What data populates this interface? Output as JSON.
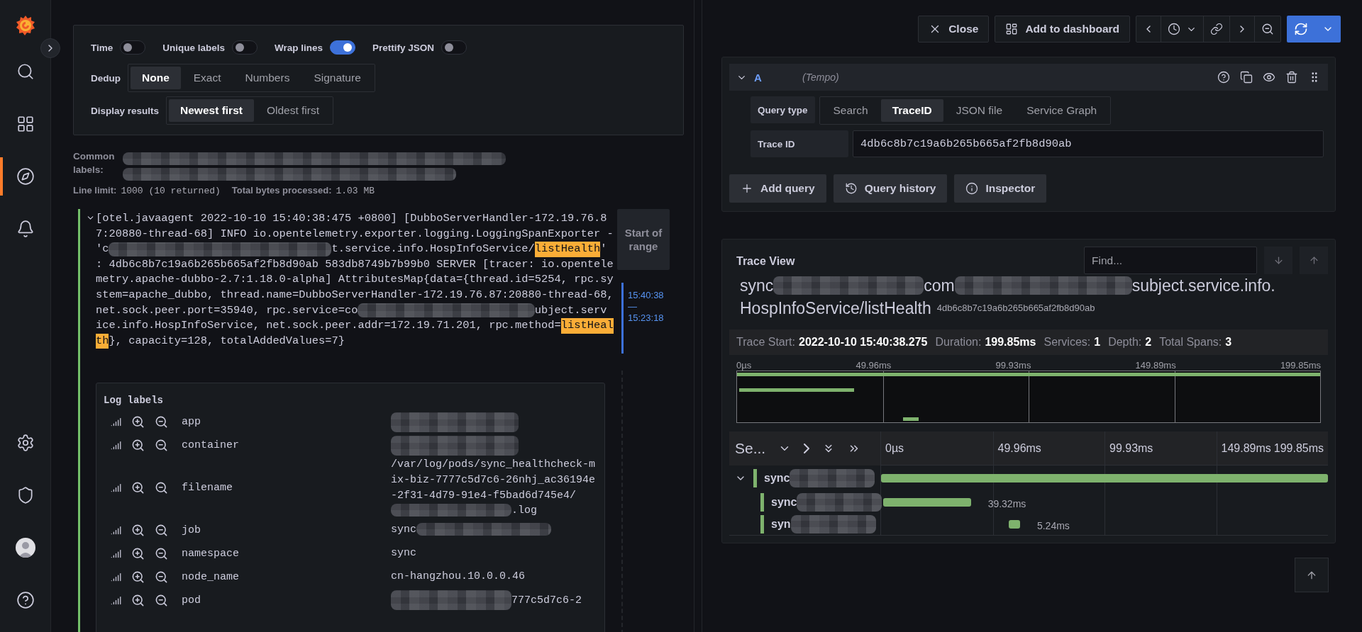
{
  "sidebar": {
    "top": [
      {
        "kind": "search",
        "selected": false
      },
      {
        "kind": "dashboards",
        "selected": false
      },
      {
        "kind": "explore",
        "selected": true
      },
      {
        "kind": "alerting",
        "selected": false
      }
    ],
    "bottom": [
      {
        "kind": "settings",
        "selected": false
      },
      {
        "kind": "shield",
        "selected": false
      },
      {
        "kind": "profile",
        "selected": false
      },
      {
        "kind": "help",
        "selected": false
      }
    ]
  },
  "logs": {
    "options": {
      "toggles": [
        {
          "label": "Time",
          "on": false
        },
        {
          "label": "Unique labels",
          "on": false
        },
        {
          "label": "Wrap lines",
          "on": true
        },
        {
          "label": "Prettify JSON",
          "on": false
        }
      ],
      "dedup": {
        "label": "Dedup",
        "options": [
          {
            "label": "None",
            "selected": true
          },
          {
            "label": "Exact",
            "selected": false
          },
          {
            "label": "Numbers",
            "selected": false
          },
          {
            "label": "Signature",
            "selected": false
          }
        ]
      },
      "display": {
        "label": "Display results",
        "options": [
          {
            "label": "Newest first",
            "selected": true
          },
          {
            "label": "Oldest first",
            "selected": false
          }
        ]
      }
    },
    "common_labels": {
      "label": "Common labels:"
    },
    "stats": [
      {
        "label": "Line limit:",
        "value": "1000 (10 returned)"
      },
      {
        "label": "Total bytes processed:",
        "value": "1.03 MB"
      }
    ],
    "entry": {
      "expanded": true,
      "lines": [
        [
          {
            "kind": "text",
            "text": "[otel.javaagent 2022-10-10 15:40:38:475 +0800] [DubboServerHandler-172.19.76.8"
          }
        ],
        [
          {
            "kind": "text",
            "text": "7:20880-thread-68] INFO io.opentelemetry.exporter.logging.LoggingSpanExporter -"
          }
        ],
        [
          {
            "kind": "text",
            "text": "'c"
          },
          {
            "kind": "redacted"
          },
          {
            "kind": "text",
            "text": "t.service.info.HospInfoService/"
          },
          {
            "kind": "highlight",
            "text": "listHealth"
          },
          {
            "kind": "text",
            "text": "'"
          }
        ],
        [
          {
            "kind": "text",
            "text": ": 4db6c8b7c19a6b265b665af2fb8d90ab 583db8749b7b99b0 SERVER [tracer: io.opentele"
          }
        ],
        [
          {
            "kind": "text",
            "text": "metry.apache-dubbo-2.7:1.18.0-alpha] AttributesMap{data={thread.id=5254, rpc.sy"
          }
        ],
        [
          {
            "kind": "text",
            "text": "stem=apache_dubbo, thread.name=DubboServerHandler-172.19.76.87:20880-thread-68,"
          }
        ],
        [
          {
            "kind": "text",
            "text": "net.sock.peer.port=35940, rpc.service=co"
          },
          {
            "kind": "redacted"
          },
          {
            "kind": "text",
            "text": "ubject.serv"
          }
        ],
        [
          {
            "kind": "text",
            "text": "ice.info.HospInfoService, net.sock.peer.addr=172.19.71.201, rpc.method="
          },
          {
            "kind": "highlight",
            "text": "listHeal"
          }
        ],
        [
          {
            "kind": "highlight",
            "text": "th"
          },
          {
            "kind": "text",
            "text": "}, capacity=128, totalAddedValues=7}"
          }
        ]
      ],
      "range_button": "Start of range",
      "range": {
        "start": "15:40:38",
        "separator": "—",
        "end": "15:23:18"
      },
      "log_labels": {
        "title": "Log labels",
        "rows": [
          {
            "name": "app",
            "redacted": true
          },
          {
            "name": "container",
            "redacted": true
          },
          {
            "name": "filename",
            "value": "/var/log/pods/sync_healthcheck-mix-biz-7777c5d7c6-26nhj_ac36194e-2f31-4d79-91e4-f5bad6d745e4/",
            "redacted": true,
            "value_end": ".log"
          },
          {
            "name": "job",
            "value": "sync",
            "redacted": true
          },
          {
            "name": "namespace",
            "value": "sync",
            "redacted": false
          },
          {
            "name": "node_name",
            "value": "cn-hangzhou.10.0.0.46",
            "redacted": false
          },
          {
            "name": "pod",
            "redacted": true,
            "value_end": "777c5d7c6-2"
          }
        ]
      }
    }
  },
  "toolbar": {
    "buttons": [
      {
        "kind": "close",
        "label": "Close"
      },
      {
        "kind": "add-dashboard",
        "label": "Add to dashboard"
      }
    ],
    "time_controls": [
      {
        "kind": "back"
      },
      {
        "kind": "time-picker"
      },
      {
        "kind": "link"
      },
      {
        "kind": "forward"
      },
      {
        "kind": "zoom-out"
      }
    ]
  },
  "query": {
    "expanded": true,
    "ref": "A",
    "datasource": "(Tempo)",
    "actions": [
      {
        "kind": "help"
      },
      {
        "kind": "copy"
      },
      {
        "kind": "eye"
      },
      {
        "kind": "delete"
      },
      {
        "kind": "drag"
      }
    ],
    "query_type": {
      "label": "Query type",
      "options": [
        {
          "label": "Search",
          "selected": false
        },
        {
          "label": "TraceID",
          "selected": true
        },
        {
          "label": "JSON file",
          "selected": false
        },
        {
          "label": "Service Graph",
          "selected": false
        }
      ]
    },
    "trace_id": {
      "label": "Trace ID",
      "value": "4db6c8b7c19a6b265b665af2fb8d90ab"
    },
    "buttons": [
      {
        "kind": "add",
        "label": "Add query"
      },
      {
        "kind": "history",
        "label": "Query history"
      },
      {
        "kind": "info",
        "label": "Inspector"
      }
    ]
  },
  "trace": {
    "title": "Trace View",
    "find": {
      "placeholder": "Find..."
    },
    "heading": {
      "lines": [
        [
          {
            "kind": "text",
            "text": "sync"
          },
          {
            "kind": "redacted"
          },
          {
            "kind": "text",
            "text": "com"
          },
          {
            "kind": "redacted"
          },
          {
            "kind": "text",
            "text": "subject.service.info."
          }
        ],
        [
          {
            "kind": "text",
            "text": "HospInfoService/listHealth"
          }
        ]
      ],
      "trace_id": "4db6c8b7c19a6b265b665af2fb8d90ab"
    },
    "summary": [
      {
        "label": "Trace Start:",
        "value": "2022-10-10 15:40:38.275"
      },
      {
        "label": "Duration:",
        "value": "199.85ms"
      },
      {
        "label": "Services:",
        "value": "1"
      },
      {
        "label": "Depth:",
        "value": "2"
      },
      {
        "label": "Total Spans:",
        "value": "3"
      }
    ],
    "minimap_ticks": [
      "0µs",
      "49.96ms",
      "99.93ms",
      "149.89ms",
      "199.85ms"
    ],
    "column_header": "Se...",
    "header_ticks": [
      "0µs",
      "49.96ms",
      "99.93ms",
      "149.89ms",
      "199.85ms"
    ],
    "spans": [
      {
        "name": "sync",
        "expanded": true,
        "children": [
          {
            "name": "sync",
            "duration": "39.32ms"
          },
          {
            "name": "syn",
            "duration": "5.24ms"
          }
        ]
      }
    ]
  }
}
